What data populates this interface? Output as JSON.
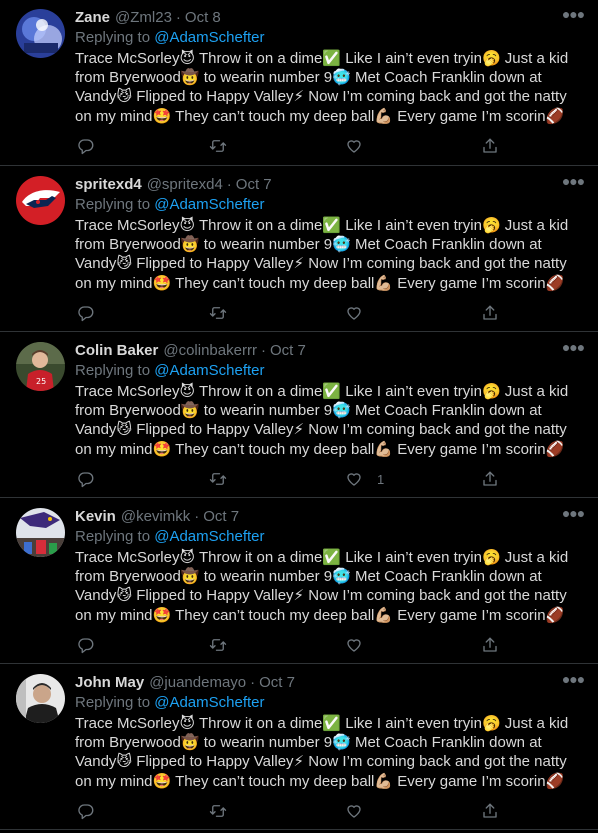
{
  "icons": {
    "reply": "reply-icon",
    "retweet": "retweet-icon",
    "like": "heart-icon",
    "share": "share-icon",
    "more": "more-icon"
  },
  "colors": {
    "background": "#000000",
    "text": "#d9d9d9",
    "secondary": "#6e767d",
    "link": "#1da1f2",
    "divider": "#2f3336"
  },
  "replying_prefix": "Replying to ",
  "tweets": [
    {
      "name": "Zane",
      "handle": "@Zml23",
      "date": "Oct 8",
      "replying_to": "@AdamSchefter",
      "text": "Trace McSorley😈 Throw it on a dime✅ Like I ain’t even tryin🥱 Just a kid from Bryerwood🤠 to wearin number 9🥶 Met Coach Franklin down at Vandy😼 Flipped to Happy Valley⚡ Now I’m coming back and got the natty on my mind🤩 They can’t touch my deep ball💪🏼 Every game I’m scorin🏈",
      "like_count": ""
    },
    {
      "name": "spritexd4",
      "handle": "@spritexd4",
      "date": "Oct 7",
      "replying_to": "@AdamSchefter",
      "text": "Trace McSorley😈 Throw it on a dime✅ Like I ain’t even tryin🥱 Just a kid from Bryerwood🤠 to wearin number 9🥶 Met Coach Franklin down at Vandy😼 Flipped to Happy Valley⚡ Now I’m coming back and got the natty on my mind🤩 They can’t touch my deep ball💪🏼 Every game I’m scorin🏈",
      "like_count": ""
    },
    {
      "name": "Colin Baker",
      "handle": "@colinbakerrr",
      "date": "Oct 7",
      "replying_to": "@AdamSchefter",
      "text": "Trace McSorley😈 Throw it on a dime✅ Like I ain’t even tryin🥱 Just a kid from Bryerwood🤠 to wearin number 9🥶 Met Coach Franklin down at Vandy😼 Flipped to Happy Valley⚡ Now I’m coming back and got the natty on my mind🤩 They can’t touch my deep ball💪🏼 Every game I’m scorin🏈",
      "like_count": "1"
    },
    {
      "name": "Kevin",
      "handle": "@kevimkk",
      "date": "Oct 7",
      "replying_to": "@AdamSchefter",
      "text": "Trace McSorley😈 Throw it on a dime✅ Like I ain’t even tryin🥱 Just a kid from Bryerwood🤠 to wearin number 9🥶 Met Coach Franklin down at Vandy😼 Flipped to Happy Valley⚡ Now I’m coming back and got the natty on my mind🤩 They can’t touch my deep ball💪🏼 Every game I’m scorin🏈",
      "like_count": ""
    },
    {
      "name": "John May",
      "handle": "@juandemayo",
      "date": "Oct 7",
      "replying_to": "@AdamSchefter",
      "text": "Trace McSorley😈 Throw it on a dime✅ Like I ain’t even tryin🥱 Just a kid from Bryerwood🤠 to wearin number 9🥶 Met Coach Franklin down at Vandy😼 Flipped to Happy Valley⚡ Now I’m coming back and got the natty on my mind🤩 They can’t touch my deep ball💪🏼 Every game I’m scorin🏈",
      "like_count": ""
    }
  ]
}
